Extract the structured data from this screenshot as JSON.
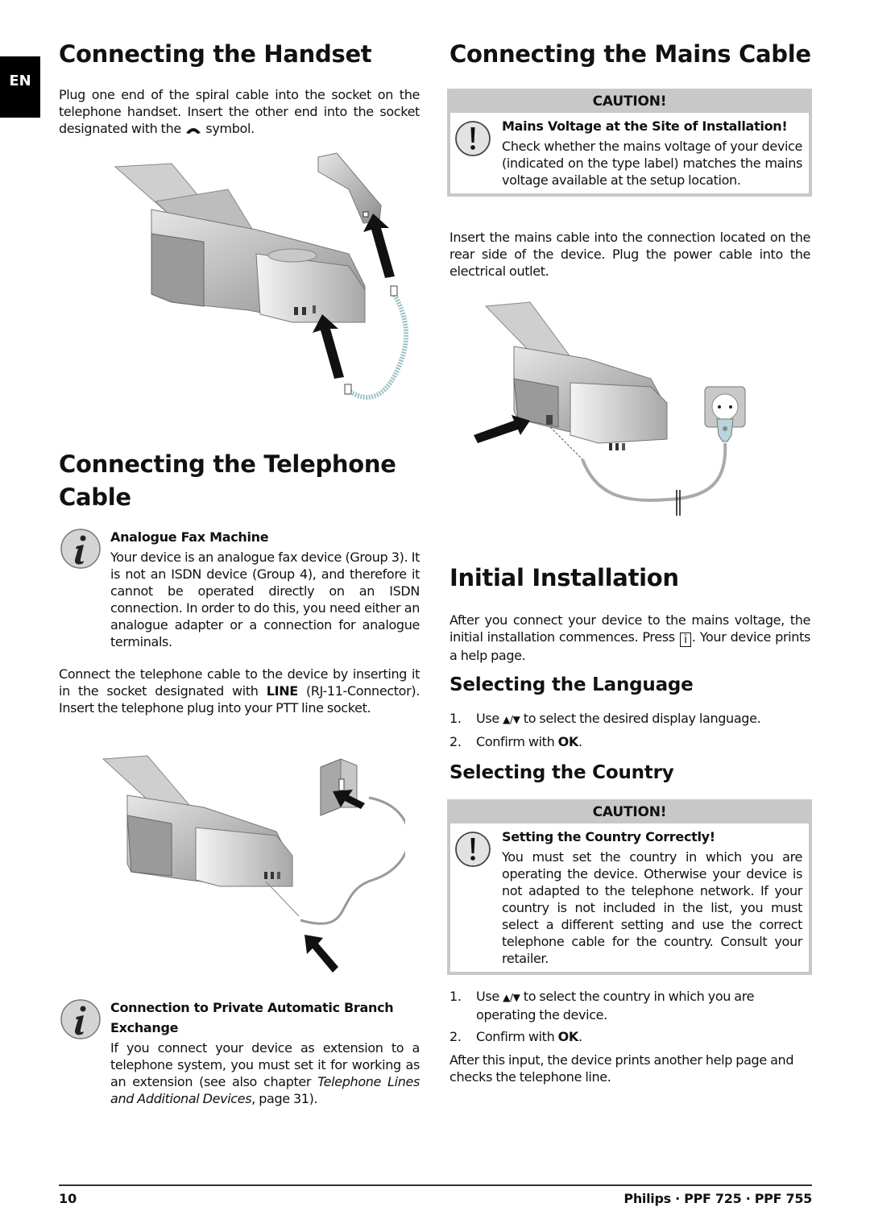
{
  "language_tab": "EN",
  "left": {
    "handset": {
      "title": "Connecting the Handset",
      "body_before_icon": "Plug one end of the spiral cable into the socket on the telephone handset. Insert the other end into the socket designated with the",
      "body_icon": "handset-icon",
      "body_after_icon": "symbol."
    },
    "telephone_cable": {
      "title_line1": "Connecting the Telephone",
      "title_line2": "Cable",
      "note1": {
        "icon": "info-icon",
        "title": "Analogue Fax Machine",
        "body": "Your device is an analogue fax device (Group 3). It is not an ISDN device (Group 4), and therefore it cannot be operated directly on an ISDN connection. In order to do this, you need either an analogue adapter or a connection for analogue terminals."
      },
      "body_part1": "Connect the telephone cable to the device by inserting it in the socket designated with",
      "body_bold": "LINE",
      "body_part2": "(RJ-11-Connector). Insert the telephone plug into your PTT line socket.",
      "note2": {
        "icon": "info-icon",
        "title": "Connection to Private Automatic Branch Exchange",
        "body_part1": "If you connect your device as extension to a telephone system, you must set it for working as an extension (see also chapter",
        "body_italic": "Telephone Lines and Additional Devices",
        "body_part2": ", page 31)."
      }
    }
  },
  "right": {
    "mains_cable": {
      "title": "Connecting the Mains Cable",
      "caution": {
        "header": "CAUTION!",
        "icon": "exclamation-icon",
        "title": "Mains Voltage at the Site of Installation!",
        "body": "Check whether the mains voltage of your device (indicated on the type label) matches the mains voltage available at the setup location."
      },
      "body": "Insert the mains cable into the connection located on the rear side of the device. Plug the power cable into the electrical outlet."
    },
    "initial_installation": {
      "title": "Initial Installation",
      "body_part1": "After you connect your device to the mains voltage, the initial installation commences. Press",
      "key": "i",
      "body_part2": ". Your device prints a help page."
    },
    "language": {
      "title": "Selecting the Language",
      "steps": [
        {
          "num": "1.",
          "pre": "Use",
          "arrows": "▲/▼",
          "post": "to select the desired display language."
        },
        {
          "num": "2.",
          "pre": "Confirm with",
          "bold": "OK",
          "post": "."
        }
      ]
    },
    "country": {
      "title": "Selecting the Country",
      "caution": {
        "header": "CAUTION!",
        "icon": "exclamation-icon",
        "title": "Setting the Country Correctly!",
        "body": "You must set the country in which you are operating the device. Otherwise your device is not adapted to the telephone network. If your country is not included in the list, you must select a different setting and use the correct telephone cable for the country. Consult your retailer."
      },
      "steps": [
        {
          "num": "1.",
          "pre": "Use",
          "arrows": "▲/▼",
          "post": "to select the country in which you are operating the device."
        },
        {
          "num": "2.",
          "pre": "Confirm with",
          "bold": "OK",
          "post": "."
        }
      ],
      "closing": "After this input, the device prints another help page and checks the telephone line."
    }
  },
  "footer": {
    "page_number": "10",
    "product": "Philips · PPF 725 · PPF 755"
  }
}
